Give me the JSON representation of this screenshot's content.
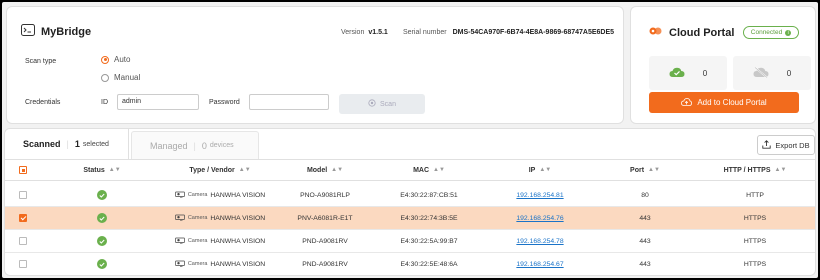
{
  "app": {
    "title": "MyBridge",
    "version_label": "Version",
    "version": "v1.5.1",
    "serial_label": "Serial number",
    "serial": "DMS-54CA970F-6B74-4E8A-9869-68747A5E6DE5"
  },
  "scan": {
    "type_label": "Scan type",
    "option_auto": "Auto",
    "option_manual": "Manual",
    "selected": "Auto",
    "credentials_label": "Credentials",
    "id_label": "ID",
    "id_value": "admin",
    "password_label": "Password",
    "password_value": "",
    "scan_button": "Scan"
  },
  "cloud": {
    "title": "Cloud Portal",
    "status": "Connected",
    "connected_count": "0",
    "disconnected_count": "0",
    "add_button": "Add to Cloud Portal"
  },
  "tabs": {
    "scanned_label": "Scanned",
    "scanned_count": "1",
    "scanned_suffix": "selected",
    "managed_label": "Managed",
    "managed_count": "0",
    "managed_suffix": "devices"
  },
  "toolbar": {
    "export_label": "Export DB"
  },
  "table": {
    "headers": {
      "status": "Status",
      "type": "Type / Vendor",
      "model": "Model",
      "mac": "MAC",
      "ip": "IP",
      "port": "Port",
      "http": "HTTP / HTTPS"
    },
    "rows": [
      {
        "selected": false,
        "type": "Camera",
        "vendor": "HANWHA VISION",
        "model": "PNO-A9081RLP",
        "mac": "E4:30:22:87:CB:51",
        "ip": "192.168.254.81",
        "port": "80",
        "protocol": "HTTP"
      },
      {
        "selected": true,
        "type": "Camera",
        "vendor": "HANWHA VISION",
        "model": "PNV-A6081R-E1T",
        "mac": "E4:30:22:74:3B:5E",
        "ip": "192.168.254.76",
        "port": "443",
        "protocol": "HTTPS"
      },
      {
        "selected": false,
        "type": "Camera",
        "vendor": "HANWHA VISION",
        "model": "PND-A9081RV",
        "mac": "E4:30:22:5A:99:B7",
        "ip": "192.168.254.78",
        "port": "443",
        "protocol": "HTTPS"
      },
      {
        "selected": false,
        "type": "Camera",
        "vendor": "HANWHA VISION",
        "model": "PND-A9081RV",
        "mac": "E4:30:22:5E:48:6A",
        "ip": "192.168.254.67",
        "port": "443",
        "protocol": "HTTPS"
      }
    ]
  },
  "colors": {
    "accent": "#f26b1d",
    "success": "#6ab04c",
    "link": "#1a73c8",
    "row_selected": "#fbd9c0"
  }
}
